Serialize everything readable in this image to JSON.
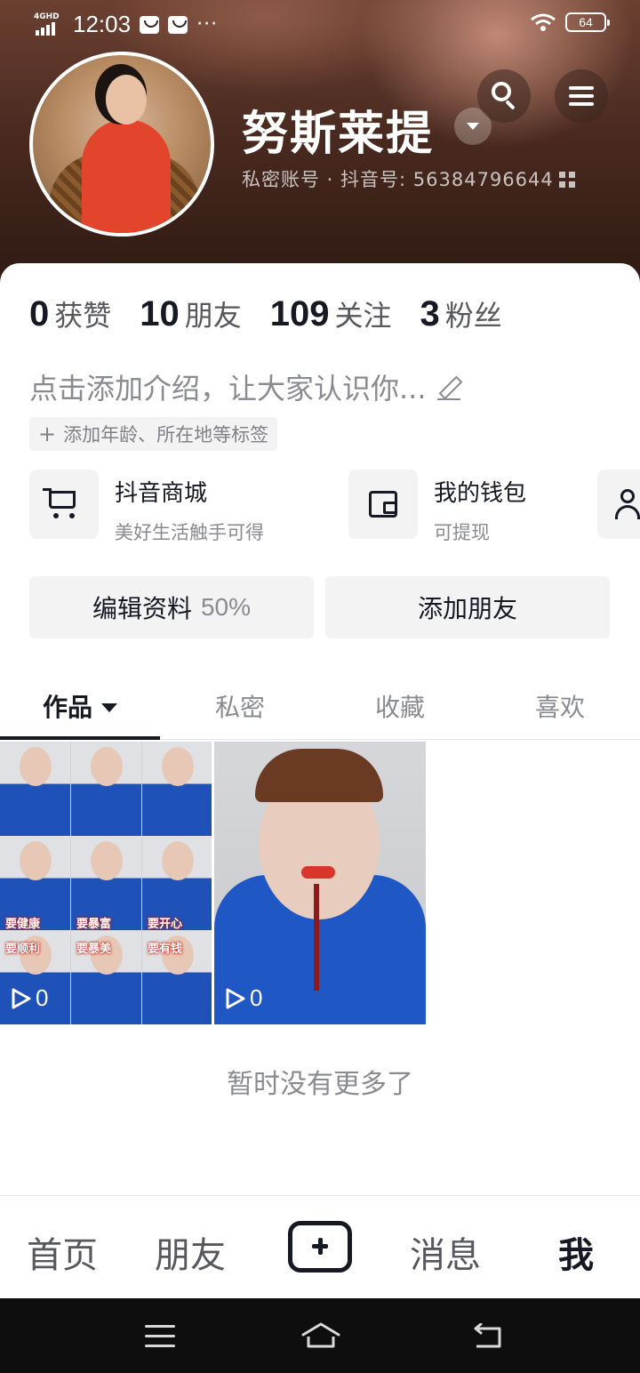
{
  "status_bar": {
    "network": "4GHD",
    "time": "12:03",
    "battery": "64",
    "notification_icons": [
      "mail-icon",
      "mail-icon",
      "more-dots-icon"
    ]
  },
  "profile": {
    "username": "努斯莱提",
    "account_line": "私密账号 · 抖音号: 56384796644",
    "stats": [
      {
        "value": "0",
        "label": "获赞"
      },
      {
        "value": "10",
        "label": "朋友"
      },
      {
        "value": "109",
        "label": "关注"
      },
      {
        "value": "3",
        "label": "粉丝"
      }
    ],
    "bio_placeholder": "点击添加介绍，让大家认识你...",
    "tag_hint": "添加年龄、所在地等标签"
  },
  "services": [
    {
      "title": "抖音商城",
      "subtitle": "美好生活触手可得",
      "icon": "cart-icon"
    },
    {
      "title": "我的钱包",
      "subtitle": "可提现",
      "icon": "wallet-icon"
    }
  ],
  "actions": {
    "edit_label": "编辑资料",
    "edit_percent": "50%",
    "add_friend_label": "添加朋友"
  },
  "tabs": [
    "作品",
    "私密",
    "收藏",
    "喜欢"
  ],
  "active_tab": "作品",
  "videos": [
    {
      "plays": "0",
      "captions": [
        "要健康",
        "要暴富",
        "要开心",
        "要顺利",
        "要暴美",
        "要有钱"
      ]
    },
    {
      "plays": "0"
    }
  ],
  "no_more_text": "暂时没有更多了",
  "bottom_nav": {
    "home": "首页",
    "friends": "朋友",
    "messages": "消息",
    "me": "我"
  },
  "colors": {
    "text_primary": "#161823",
    "text_secondary": "#8a8b91",
    "chip_bg": "#f3f3f4"
  }
}
